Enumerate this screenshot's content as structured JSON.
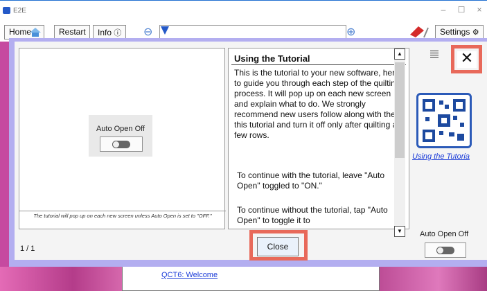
{
  "window": {
    "title": "E2E",
    "minimize": "–",
    "maximize": "☐",
    "close": "×"
  },
  "toolbar": {
    "home": "Home",
    "restart": "Restart",
    "info": "Info",
    "info_icon": "ⓘ",
    "zoom_out_icon": "⊖",
    "zoom_in_icon": "⊕",
    "settings": "Settings",
    "settings_icon": "⚙"
  },
  "tutorial": {
    "left_pane": {
      "auto_open_label": "Auto Open Off",
      "note": "The tutorial will pop up on each new screen unless Auto Open is set to \"OFF.\""
    },
    "title": "Using the Tutorial",
    "body": "This is the tutorial to your new software, here to guide you through each step of the quilting process. It will pop up on each new screen and explain what to do. We strongly recommend new users follow along with the this tutorial and turn it off only after quilting a few rows.",
    "para2": "To continue with the tutorial, leave \"Auto Open\" toggled to \"ON.\"",
    "para3": "To continue without the tutorial, tap \"Auto Open\" to toggle it to",
    "page_counter": "1 / 1",
    "close_button": "Close",
    "close_x": "✕",
    "qr_link": "Using the Tutoria",
    "auto_open_right_label": "Auto Open Off",
    "scroll_up": "▲",
    "scroll_down": "▼"
  },
  "background": {
    "welcome_link": "QCT6: Welcome"
  },
  "colors": {
    "overlay": "#b3aef0",
    "highlight": "#e8695a",
    "link": "#1a3bd8",
    "accent": "#2459c8"
  }
}
